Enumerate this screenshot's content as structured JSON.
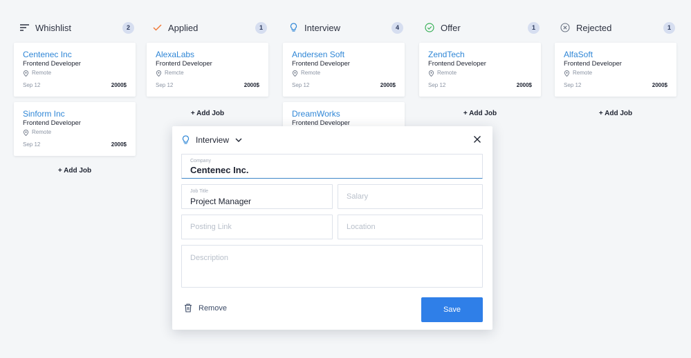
{
  "columns": [
    {
      "title": "Whishlist",
      "count": "2",
      "icon": "filter-lines-icon",
      "cards": [
        {
          "company": "Centenec Inc",
          "role": "Frontend Developer",
          "location": "Remote",
          "date": "Sep 12",
          "salary": "2000$"
        },
        {
          "company": "Sinform Inc",
          "role": "Frontend Developer",
          "location": "Remote",
          "date": "Sep 12",
          "salary": "2000$"
        }
      ],
      "add_label": "+ Add Job"
    },
    {
      "title": "Applied",
      "count": "1",
      "icon": "checkmark-icon",
      "cards": [
        {
          "company": "AlexaLabs",
          "role": "Fronterd Developer",
          "location": "Remcte",
          "date": "Sep 12",
          "salary": "2000$"
        }
      ],
      "add_label": "+ Add Job"
    },
    {
      "title": "Interview",
      "count": "4",
      "icon": "lightbulb-icon",
      "cards": [
        {
          "company": "Andersen Soft",
          "role": "Frontend Developer",
          "location": "Remote",
          "date": "Sep 12",
          "salary": "2000$"
        },
        {
          "company": "DreamWorks",
          "role": "Frontend Developer"
        }
      ]
    },
    {
      "title": "Offer",
      "count": "1",
      "icon": "check-circle-icon",
      "cards": [
        {
          "company": "ZendTech",
          "role": "Frontend Developer",
          "location": "Remote",
          "date": "Sep 12",
          "salary": "2000$"
        }
      ],
      "add_label": "+ Add Job"
    },
    {
      "title": "Rejected",
      "count": "1",
      "icon": "x-circle-icon",
      "cards": [
        {
          "company": "AlfaSoft",
          "role": "Frontend Developer",
          "location": "Remote",
          "date": "Sep 12",
          "salary": "2000$"
        }
      ],
      "add_label": "+ Add Job"
    }
  ],
  "modal": {
    "status": "Interview",
    "status_icon": "lightbulb-icon",
    "company": {
      "label": "Company",
      "value": "Centenec Inc."
    },
    "job_title": {
      "label": "Job Title",
      "value": "Project Manager"
    },
    "salary_placeholder": "Salary",
    "posting_link_placeholder": "Posting Link",
    "location_placeholder": "Location",
    "description_placeholder": "Description",
    "remove_label": "Remove",
    "save_label": "Save"
  },
  "colors": {
    "accent": "#2f7fe8",
    "link": "#2f86d6",
    "applied_icon": "#f07b3a",
    "interview_icon": "#2f86d6",
    "offer_icon": "#3bb15a",
    "badge_bg": "#d6def0"
  }
}
